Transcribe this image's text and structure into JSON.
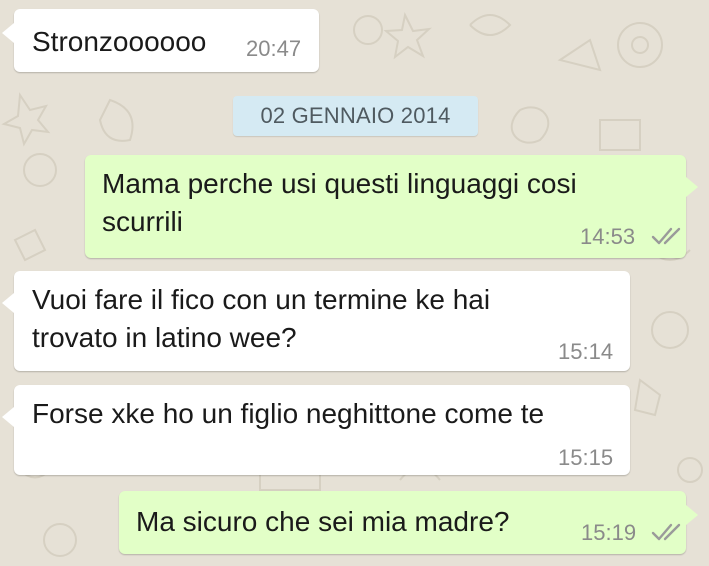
{
  "chat": {
    "date_separator": "02 GENNAIO 2014",
    "messages": [
      {
        "direction": "incoming",
        "text": "Stronzoooooo",
        "time": "20:47"
      },
      {
        "direction": "outgoing",
        "text": "Mama perche usi questi linguaggi cosi\nscurrili",
        "time": "14:53",
        "status": "double-check-icon"
      },
      {
        "direction": "incoming",
        "text": "Vuoi fare il fico con un termine ke hai\ntrovato in latino wee?",
        "time": "15:14"
      },
      {
        "direction": "incoming",
        "text": "Forse xke ho un figlio neghittone come te",
        "time": "15:15"
      },
      {
        "direction": "outgoing",
        "text": "Ma sicuro che sei mia madre?",
        "time": "15:19",
        "status": "double-check-icon"
      }
    ]
  },
  "colors": {
    "wallpaper": "#e6e1d6",
    "incoming_bubble": "#ffffff",
    "outgoing_bubble": "#e2ffc7",
    "date_pill": "#d5eaf3",
    "timestamp": "#8a8a8a"
  }
}
